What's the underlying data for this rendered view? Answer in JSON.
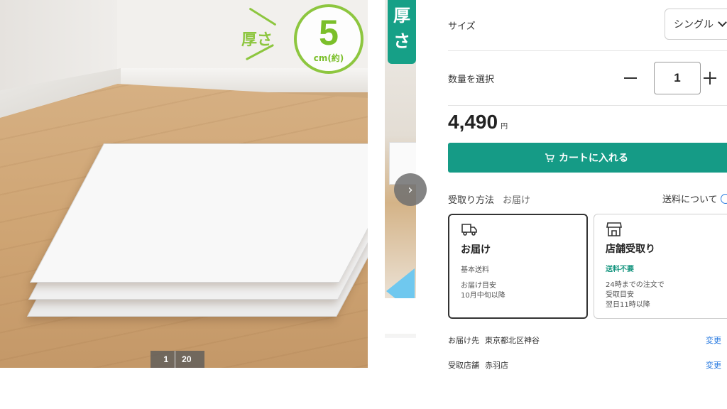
{
  "gallery": {
    "badge": {
      "label": "厚さ",
      "value": "5",
      "unit": "cm(約)"
    },
    "counter": {
      "current": "1",
      "total": "20"
    },
    "thumb_tag": "厚さ",
    "next_arrow": "›"
  },
  "product": {
    "size": {
      "label": "サイズ",
      "selected": "シングル"
    },
    "quantity": {
      "label": "数量を選択",
      "value": "1"
    },
    "price": {
      "amount": "4,490",
      "unit": "円"
    },
    "cart_button": "カートに入れる",
    "receive": {
      "label": "受取り方法",
      "selected": "お届け",
      "shipping_link": "送料について"
    },
    "options": [
      {
        "title": "お届け",
        "sub": "基本送料",
        "lines": [
          "お届け目安",
          "10月中旬以降"
        ]
      },
      {
        "title": "店舗受取り",
        "sub": "送料不要",
        "lines": [
          "24時までの注文で",
          "受取目安",
          "翌日11時以降"
        ]
      }
    ],
    "address": {
      "label": "お届け先",
      "value": "東京都北区神谷",
      "change": "変更"
    },
    "store": {
      "label": "受取店舗",
      "value": "赤羽店",
      "change": "変更"
    }
  },
  "colors": {
    "accent_green": "#159b86",
    "badge_green": "#8dc63f",
    "link_blue": "#2a7be0"
  }
}
